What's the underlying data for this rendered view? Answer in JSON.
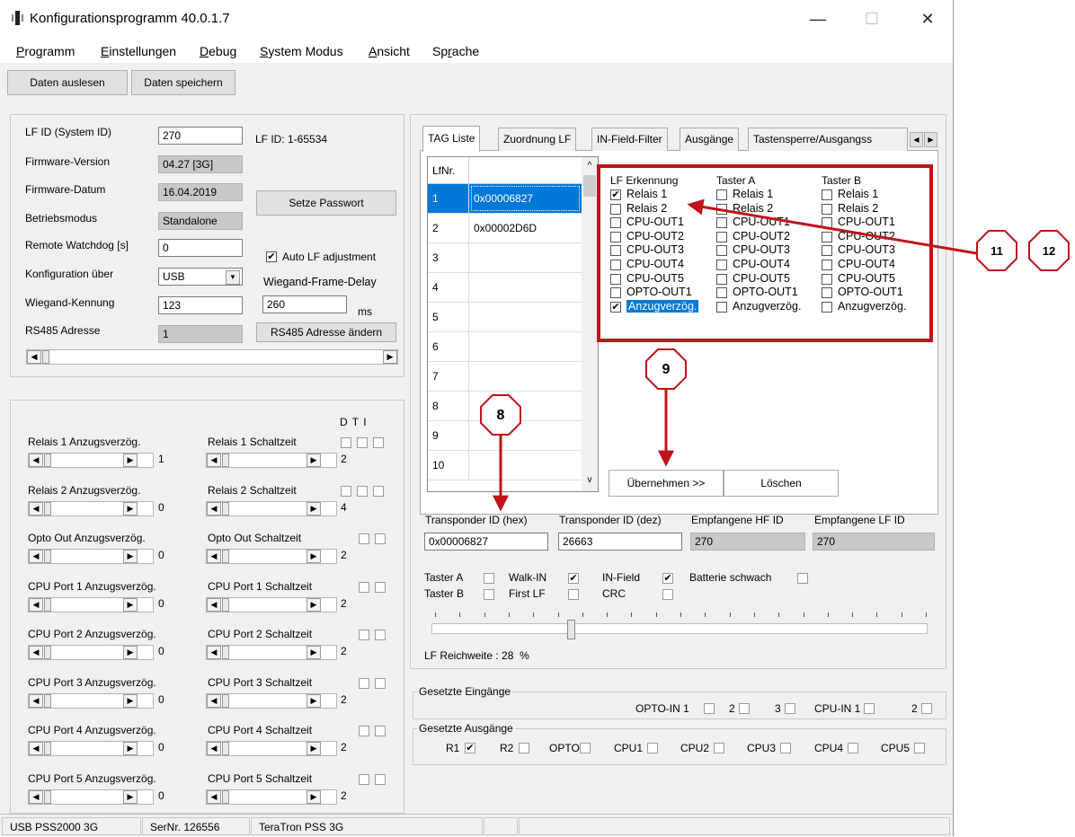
{
  "window": {
    "title": "Konfigurationsprogramm 40.0.1.7",
    "min": "—",
    "max": "☐",
    "close": "✕"
  },
  "menu": [
    {
      "u": "P",
      "rest": "rogramm"
    },
    {
      "u": "E",
      "rest": "instellungen"
    },
    {
      "u": "D",
      "rest": "ebug"
    },
    {
      "u": "S",
      "rest": "ystem Modus"
    },
    {
      "u": "A",
      "rest": "nsicht"
    },
    {
      "pre": "Sp",
      "u": "r",
      "rest": "ache"
    }
  ],
  "toolbar": {
    "read": "Daten auslesen",
    "save": "Daten speichern"
  },
  "config": {
    "lf_id_label": "LF ID (System ID)",
    "lf_id": "270",
    "lf_range": "LF ID: 1-65534",
    "fw_version_label": "Firmware-Version",
    "fw_version": "04.27 [3G]",
    "fw_date_label": "Firmware-Datum",
    "fw_date": "16.04.2019",
    "mode_label": "Betriebsmodus",
    "mode": "Standalone",
    "watchdog_label": "Remote Watchdog [s]",
    "watchdog": "0",
    "config_via_label": "Konfiguration über",
    "config_via": "USB",
    "wiegand_label": "Wiegand-Kennung",
    "wiegand": "123",
    "rs485_label": "RS485 Adresse",
    "rs485": "1",
    "set_password": "Setze Passwort",
    "auto_lf": "Auto LF adjustment",
    "wfd_label": "Wiegand-Frame-Delay",
    "wfd": "260",
    "wfd_unit": "ms",
    "rs485_change": "RS485 Adresse ändern"
  },
  "relays": {
    "dti": "D  T  I",
    "rows": [
      {
        "delay_label": "Relais 1 Anzugsverzög.",
        "delay": "1",
        "switch_label": "Relais 1 Schaltzeit",
        "switch": "2",
        "checks": 3
      },
      {
        "delay_label": "Relais 2  Anzugsverzög.",
        "delay": "0",
        "switch_label": "Relais 2 Schaltzeit",
        "switch": "4",
        "checks": 3
      },
      {
        "delay_label": "Opto Out  Anzugsverzög.",
        "delay": "0",
        "switch_label": "Opto Out Schaltzeit",
        "switch": "2",
        "checks": 2
      },
      {
        "delay_label": "CPU Port 1 Anzugsverzög.",
        "delay": "0",
        "switch_label": "CPU Port 1 Schaltzeit",
        "switch": "2",
        "checks": 2
      },
      {
        "delay_label": "CPU Port 2  Anzugsverzög.",
        "delay": "0",
        "switch_label": "CPU Port 2 Schaltzeit",
        "switch": "2",
        "checks": 2
      },
      {
        "delay_label": "CPU Port 3  Anzugsverzög.",
        "delay": "0",
        "switch_label": "CPU Port 3 Schaltzeit",
        "switch": "2",
        "checks": 2
      },
      {
        "delay_label": "CPU Port 4  Anzugsverzög.",
        "delay": "0",
        "switch_label": "CPU Port 4 Schaltzeit",
        "switch": "2",
        "checks": 2
      },
      {
        "delay_label": "CPU Port 5  Anzugsverzög.",
        "delay": "0",
        "switch_label": "CPU Port 5 Schaltzeit",
        "switch": "2",
        "checks": 2
      }
    ]
  },
  "tabs": [
    "TAG Liste",
    "Zuordnung LF",
    "IN-Field-Filter",
    "Ausgänge",
    "Tastensperre/Ausgangss"
  ],
  "taglist": {
    "header": "LfNr.",
    "rows": [
      {
        "n": "1",
        "id": "0x00006827",
        "selected": true
      },
      {
        "n": "2",
        "id": "0x00002D6D"
      },
      {
        "n": "3",
        "id": ""
      },
      {
        "n": "4",
        "id": ""
      },
      {
        "n": "5",
        "id": ""
      },
      {
        "n": "6",
        "id": ""
      },
      {
        "n": "7",
        "id": ""
      },
      {
        "n": "8",
        "id": ""
      },
      {
        "n": "9",
        "id": ""
      },
      {
        "n": "10",
        "id": ""
      }
    ]
  },
  "assign": {
    "headers": [
      "LF Erkennung",
      "Taster A",
      "Taster B"
    ],
    "items": [
      "Relais 1",
      "Relais 2",
      "CPU-OUT1",
      "CPU-OUT2",
      "CPU-OUT3",
      "CPU-OUT4",
      "CPU-OUT5",
      "OPTO-OUT1",
      "Anzugverzög."
    ],
    "checked_lf": [
      0,
      8
    ],
    "apply": "Übernehmen >>",
    "clear": "Löschen"
  },
  "transponder": {
    "hex_label": "Transponder ID (hex)",
    "hex": "0x00006827",
    "dec_label": "Transponder ID (dez)",
    "dec": "26663",
    "hf_label": "Empfangene HF ID",
    "hf": "270",
    "lf_label": "Empfangene LF ID",
    "lf": "270"
  },
  "flags": {
    "taster_a": "Taster A",
    "taster_b": "Taster B",
    "walk_in": "Walk-IN",
    "first_lf": "First LF",
    "in_field": "IN-Field",
    "crc": "CRC",
    "battery": "Batterie schwach"
  },
  "reichweite": {
    "label": "LF Reichweite :",
    "value": "28",
    "unit": "%",
    "level_percent": 28
  },
  "inputs": {
    "title": "Gesetzte Eingänge",
    "opto": "OPTO-IN 1",
    "two": "2",
    "three": "3",
    "cpu": "CPU-IN 1",
    "cpu2": "2"
  },
  "outputs": {
    "title": "Gesetzte Ausgänge",
    "items": [
      "R1",
      "R2",
      "OPTO",
      "CPU1",
      "CPU2",
      "CPU3",
      "CPU4",
      "CPU5"
    ]
  },
  "annotations": [
    "11",
    "12",
    "9",
    "8"
  ],
  "statusbar": [
    "USB PSS2000 3G",
    "SerNr. 126556",
    "TeraTron PSS 3G"
  ],
  "colors": {
    "annotation": "#c0121a",
    "selection": "#0078d7"
  }
}
